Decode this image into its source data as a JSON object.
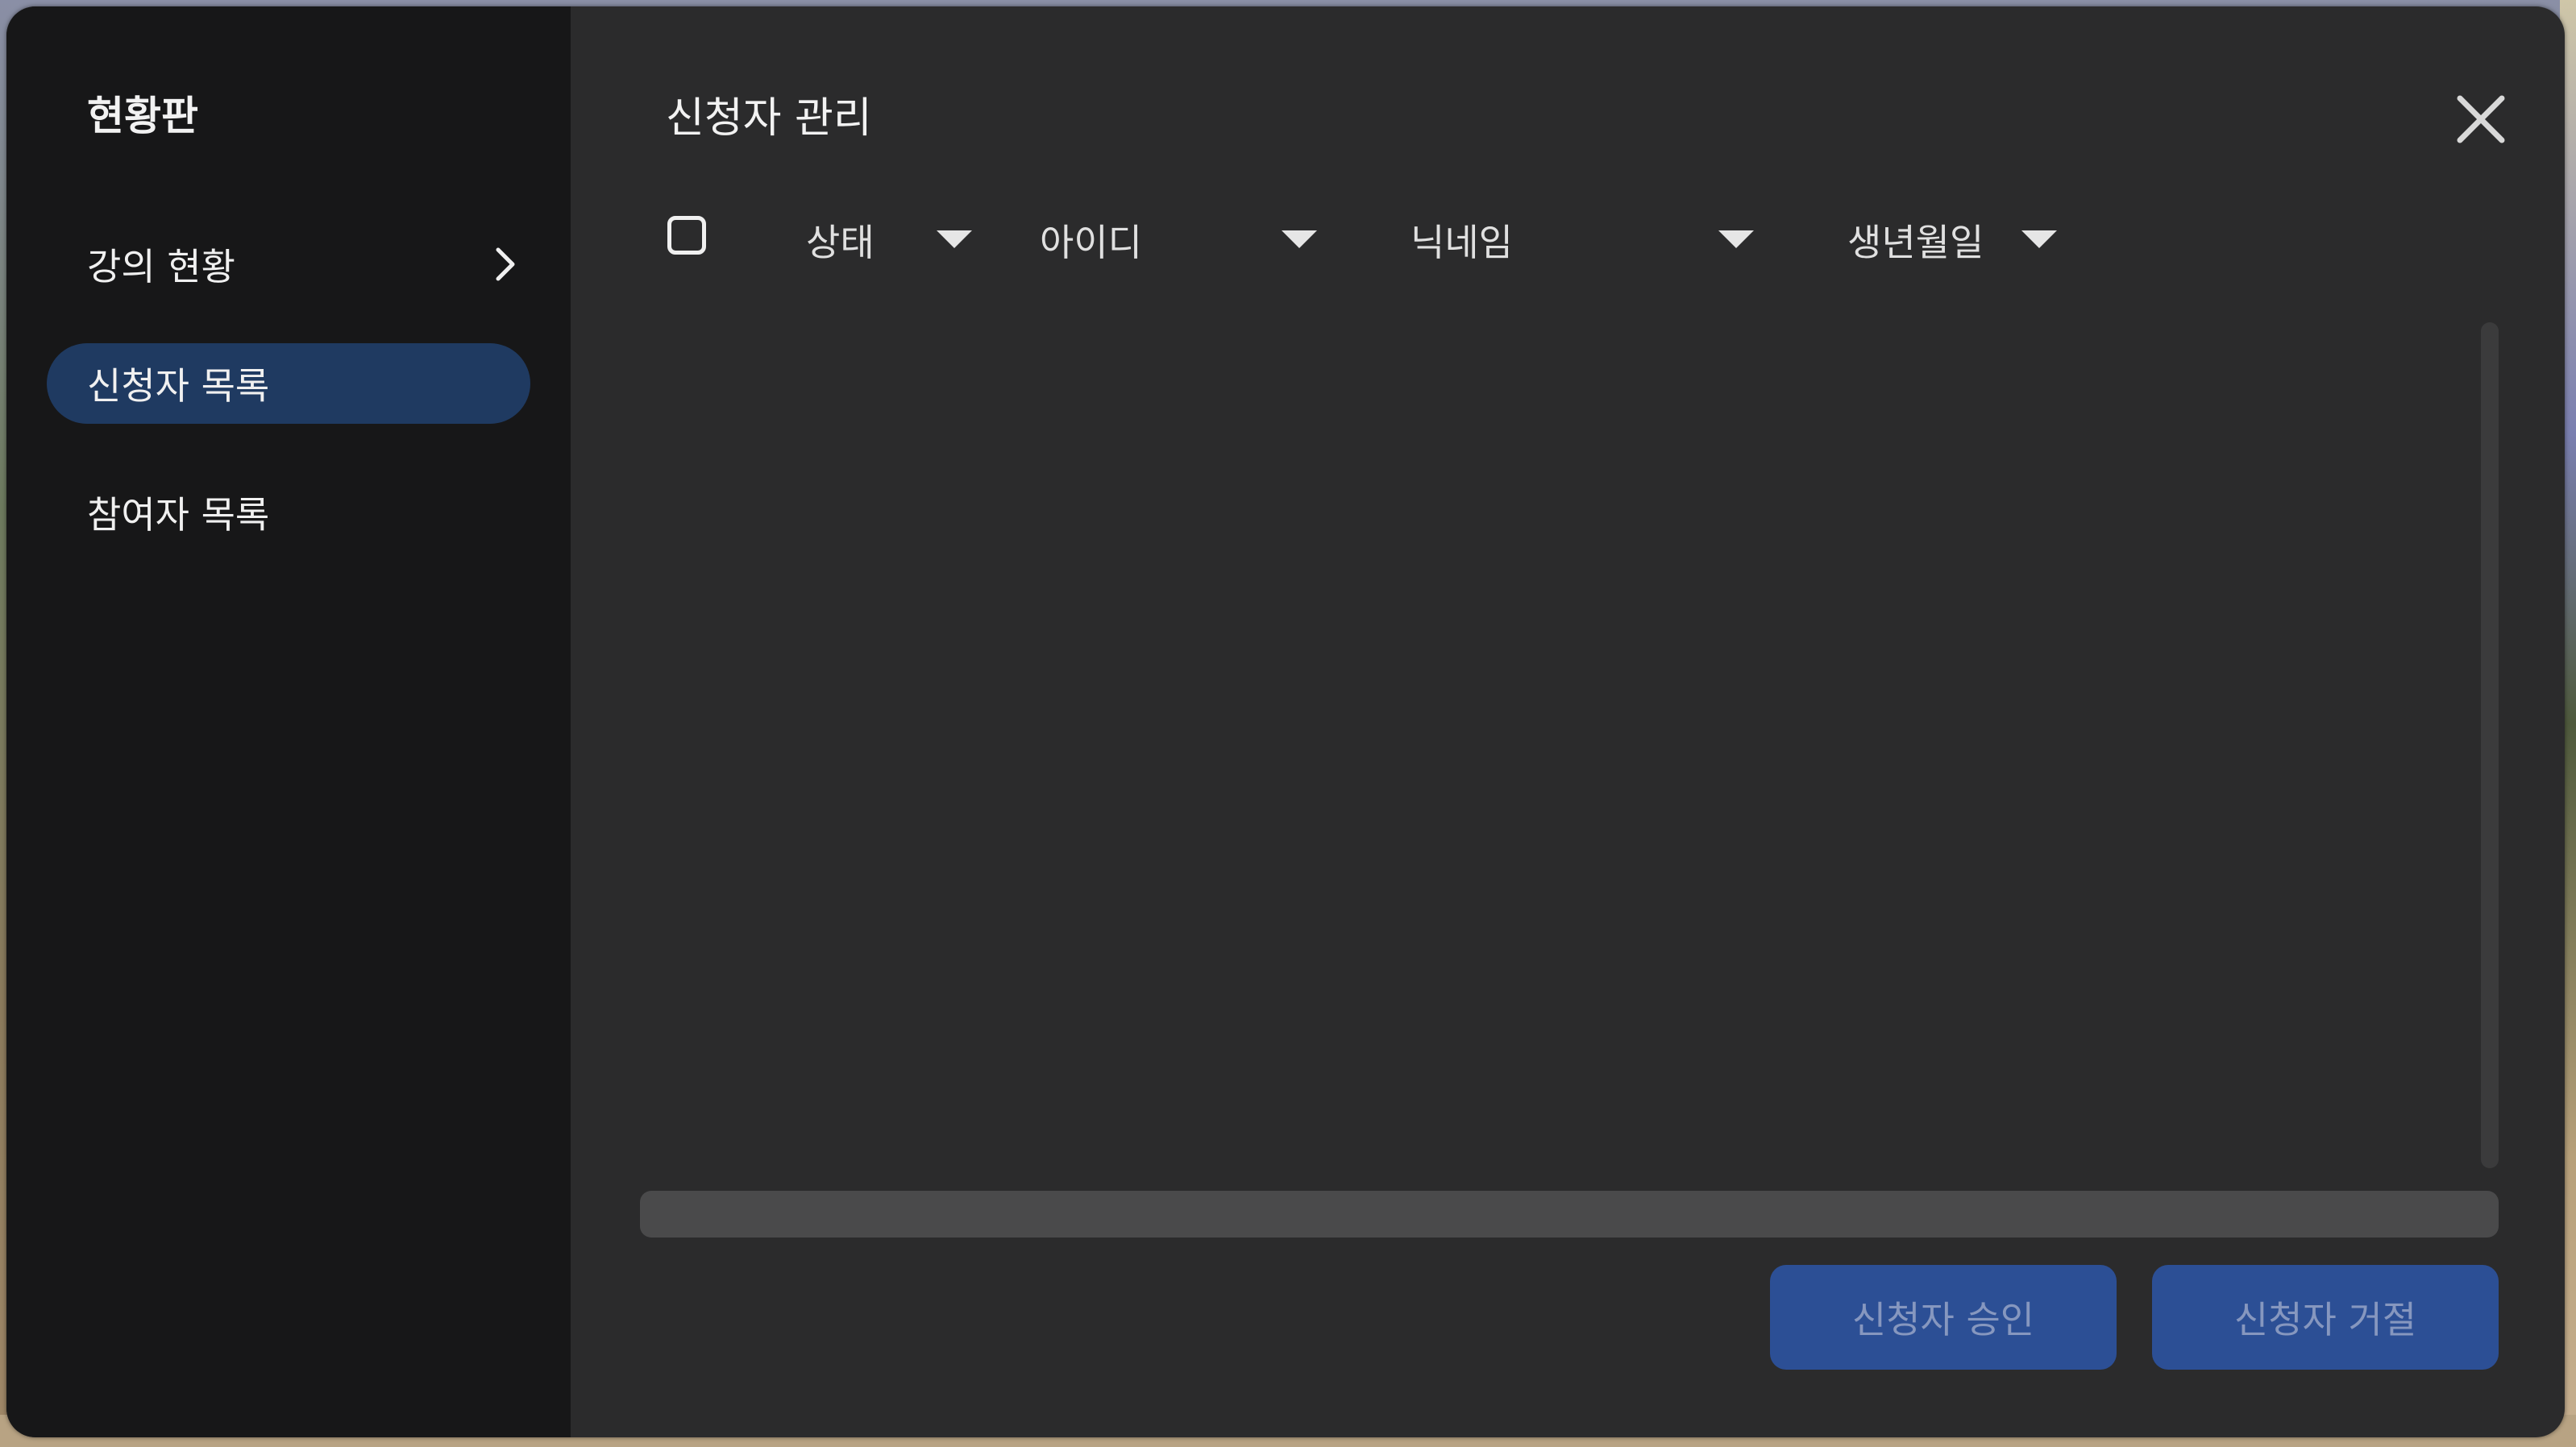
{
  "sidebar": {
    "title": "현황판",
    "items": [
      {
        "label": "강의 현황",
        "has_chevron": true,
        "active": false
      },
      {
        "label": "신청자 목록",
        "has_chevron": false,
        "active": true
      },
      {
        "label": "참여자 목록",
        "has_chevron": false,
        "active": false
      }
    ]
  },
  "main": {
    "title": "신청자 관리",
    "columns": [
      {
        "label": "상태"
      },
      {
        "label": "아이디"
      },
      {
        "label": "닉네임"
      },
      {
        "label": "생년월일"
      }
    ],
    "rows": [],
    "approve_label": "신청자 승인",
    "reject_label": "신청자 거절"
  },
  "colors": {
    "panel_bg": "#2b2b2c",
    "sidebar_bg": "#171718",
    "active_item": "#1f3a61",
    "button_bg": "#2c4f95",
    "button_text": "#8697bf"
  },
  "icons": {
    "close": "close-icon",
    "chevron": "chevron-right-icon",
    "caret": "caret-down-icon",
    "checkbox": "checkbox-icon"
  }
}
